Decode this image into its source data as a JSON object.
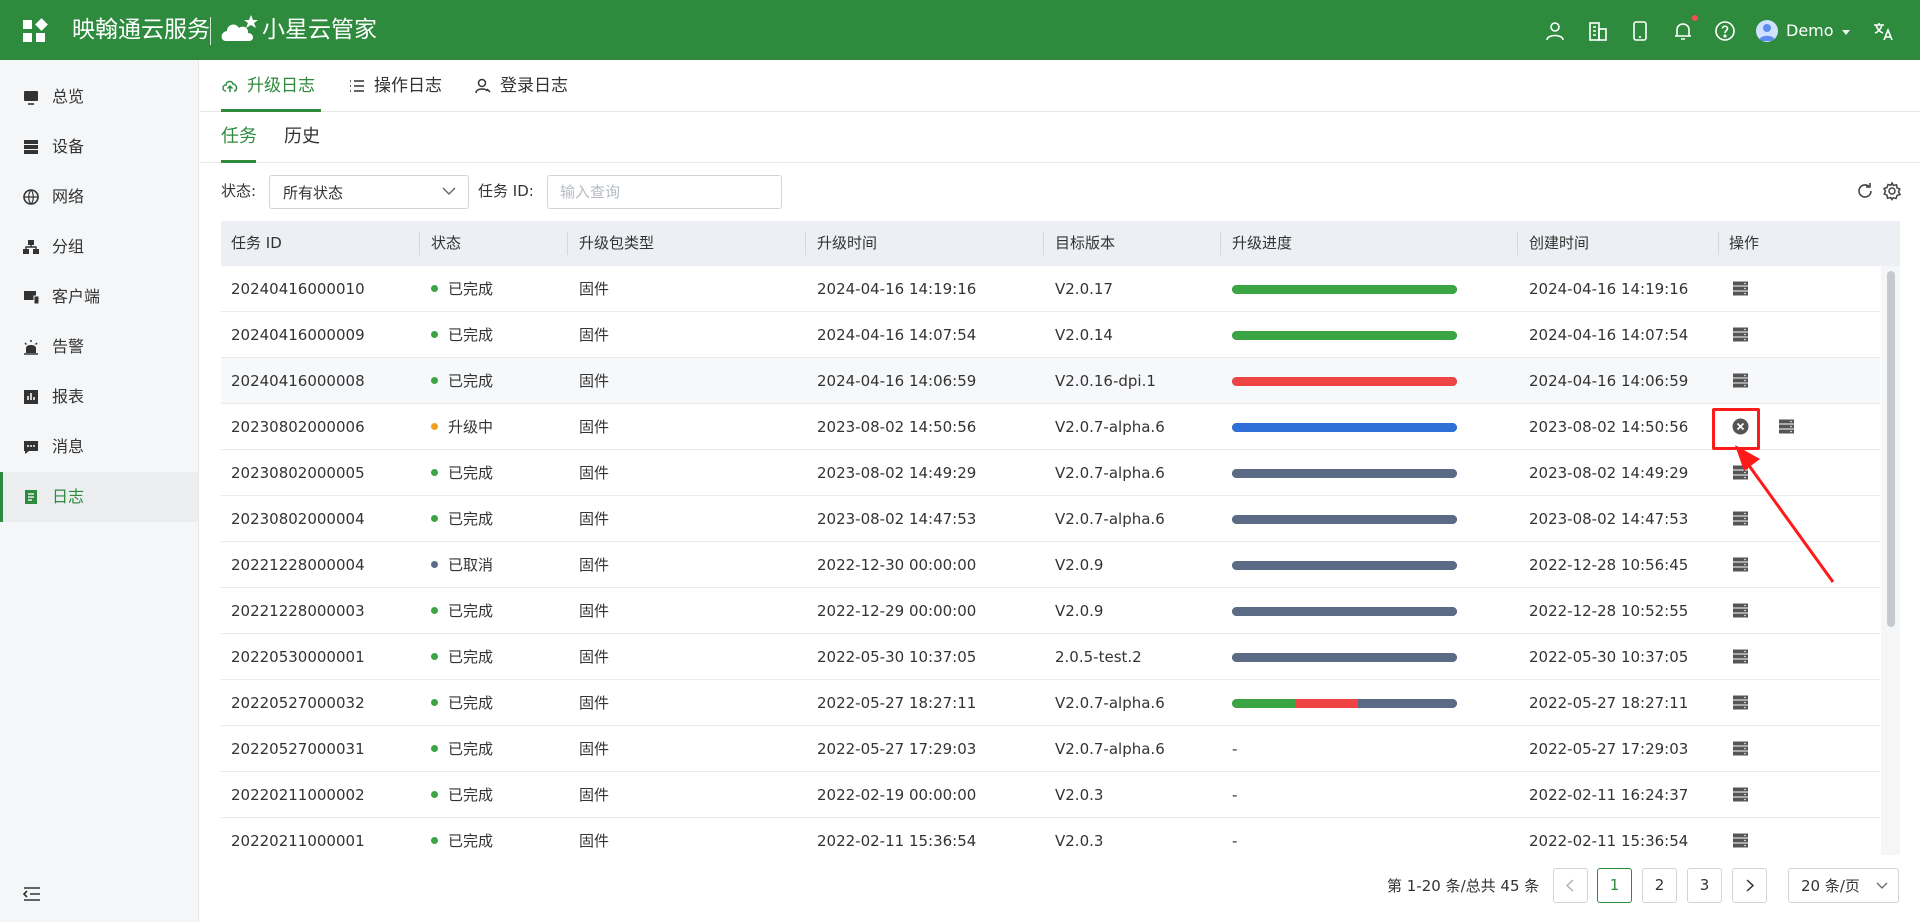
{
  "header": {
    "brand": "映翰通云服务",
    "sub_brand": "小星云管家",
    "user": "Demo"
  },
  "sidebar": {
    "items": [
      {
        "label": "总览",
        "icon": "monitor-icon"
      },
      {
        "label": "设备",
        "icon": "server-icon"
      },
      {
        "label": "网络",
        "icon": "globe-icon"
      },
      {
        "label": "分组",
        "icon": "group-icon"
      },
      {
        "label": "客户端",
        "icon": "client-icon"
      },
      {
        "label": "告警",
        "icon": "alarm-icon"
      },
      {
        "label": "报表",
        "icon": "report-icon"
      },
      {
        "label": "消息",
        "icon": "message-icon"
      },
      {
        "label": "日志",
        "icon": "log-icon",
        "active": true
      }
    ]
  },
  "top_tabs": [
    {
      "label": "升级日志",
      "icon": "cloud-upload-icon",
      "active": true
    },
    {
      "label": "操作日志",
      "icon": "list-icon"
    },
    {
      "label": "登录日志",
      "icon": "user-login-icon"
    }
  ],
  "sub_tabs": [
    {
      "label": "任务",
      "active": true
    },
    {
      "label": "历史"
    }
  ],
  "filters": {
    "status_label": "状态:",
    "status_value": "所有状态",
    "task_id_label": "任务 ID:",
    "task_id_placeholder": "输入查询"
  },
  "table": {
    "columns": [
      "任务 ID",
      "状态",
      "升级包类型",
      "升级时间",
      "目标版本",
      "升级进度",
      "创建时间",
      "操作"
    ],
    "rows": [
      {
        "id": "20240416000010",
        "status": "已完成",
        "status_color": "#3aa542",
        "type": "固件",
        "upgrade_time": "2024-04-16 14:19:16",
        "version": "V2.0.17",
        "progress": [
          {
            "color": "#3aa542",
            "fraction": 1.0
          }
        ],
        "created": "2024-04-16 14:19:16",
        "actions": [
          "detail-icon"
        ]
      },
      {
        "id": "20240416000009",
        "status": "已完成",
        "status_color": "#3aa542",
        "type": "固件",
        "upgrade_time": "2024-04-16 14:07:54",
        "version": "V2.0.14",
        "progress": [
          {
            "color": "#3aa542",
            "fraction": 1.0
          }
        ],
        "created": "2024-04-16 14:07:54",
        "actions": [
          "detail-icon"
        ]
      },
      {
        "id": "20240416000008",
        "status": "已完成",
        "status_color": "#3aa542",
        "type": "固件",
        "upgrade_time": "2024-04-16 14:06:59",
        "version": "V2.0.16-dpi.1",
        "progress": [
          {
            "color": "#ef4444",
            "fraction": 1.0
          }
        ],
        "created": "2024-04-16 14:06:59",
        "actions": [
          "detail-icon"
        ]
      },
      {
        "id": "20230802000006",
        "status": "升级中",
        "status_color": "#f0a020",
        "type": "固件",
        "upgrade_time": "2023-08-02 14:50:56",
        "version": "V2.0.7-alpha.6",
        "progress": [
          {
            "color": "#2f6fd8",
            "fraction": 1.0
          }
        ],
        "created": "2023-08-02 14:50:56",
        "actions": [
          "cancel-icon",
          "detail-icon"
        ]
      },
      {
        "id": "20230802000005",
        "status": "已完成",
        "status_color": "#3aa542",
        "type": "固件",
        "upgrade_time": "2023-08-02 14:49:29",
        "version": "V2.0.7-alpha.6",
        "progress": [
          {
            "color": "#5b6b85",
            "fraction": 1.0
          }
        ],
        "created": "2023-08-02 14:49:29",
        "actions": [
          "detail-icon"
        ]
      },
      {
        "id": "20230802000004",
        "status": "已完成",
        "status_color": "#3aa542",
        "type": "固件",
        "upgrade_time": "2023-08-02 14:47:53",
        "version": "V2.0.7-alpha.6",
        "progress": [
          {
            "color": "#5b6b85",
            "fraction": 1.0
          }
        ],
        "created": "2023-08-02 14:47:53",
        "actions": [
          "detail-icon"
        ]
      },
      {
        "id": "20221228000004",
        "status": "已取消",
        "status_color": "#5b6b85",
        "type": "固件",
        "upgrade_time": "2022-12-30 00:00:00",
        "version": "V2.0.9",
        "progress": [
          {
            "color": "#5b6b85",
            "fraction": 1.0
          }
        ],
        "created": "2022-12-28 10:56:45",
        "actions": [
          "detail-icon"
        ]
      },
      {
        "id": "20221228000003",
        "status": "已完成",
        "status_color": "#3aa542",
        "type": "固件",
        "upgrade_time": "2022-12-29 00:00:00",
        "version": "V2.0.9",
        "progress": [
          {
            "color": "#5b6b85",
            "fraction": 1.0
          }
        ],
        "created": "2022-12-28 10:52:55",
        "actions": [
          "detail-icon"
        ]
      },
      {
        "id": "20220530000001",
        "status": "已完成",
        "status_color": "#3aa542",
        "type": "固件",
        "upgrade_time": "2022-05-30 10:37:05",
        "version": "2.0.5-test.2",
        "progress": [
          {
            "color": "#5b6b85",
            "fraction": 1.0
          }
        ],
        "created": "2022-05-30 10:37:05",
        "actions": [
          "detail-icon"
        ]
      },
      {
        "id": "20220527000032",
        "status": "已完成",
        "status_color": "#3aa542",
        "type": "固件",
        "upgrade_time": "2022-05-27 18:27:11",
        "version": "V2.0.7-alpha.6",
        "progress": [
          {
            "color": "#3aa542",
            "fraction": 0.28
          },
          {
            "color": "#ef4444",
            "fraction": 0.28
          },
          {
            "color": "#5b6b85",
            "fraction": 0.44
          }
        ],
        "created": "2022-05-27 18:27:11",
        "actions": [
          "detail-icon"
        ]
      },
      {
        "id": "20220527000031",
        "status": "已完成",
        "status_color": "#3aa542",
        "type": "固件",
        "upgrade_time": "2022-05-27 17:29:03",
        "version": "V2.0.7-alpha.6",
        "progress_text": "-",
        "created": "2022-05-27 17:29:03",
        "actions": [
          "detail-icon"
        ]
      },
      {
        "id": "20220211000002",
        "status": "已完成",
        "status_color": "#3aa542",
        "type": "固件",
        "upgrade_time": "2022-02-19 00:00:00",
        "version": "V2.0.3",
        "progress_text": "-",
        "created": "2022-02-11 16:24:37",
        "actions": [
          "detail-icon"
        ]
      },
      {
        "id": "20220211000001",
        "status": "已完成",
        "status_color": "#3aa542",
        "type": "固件",
        "upgrade_time": "2022-02-11 15:36:54",
        "version": "V2.0.3",
        "progress_text": "-",
        "created": "2022-02-11 15:36:54",
        "actions": [
          "detail-icon"
        ]
      }
    ]
  },
  "pagination": {
    "info": "第 1-20 条/总共 45 条",
    "pages": [
      "1",
      "2",
      "3"
    ],
    "current": "1",
    "page_size": "20 条/页"
  },
  "colors": {
    "brand": "#2e8b3e",
    "annotation": "#ff1a1a"
  }
}
